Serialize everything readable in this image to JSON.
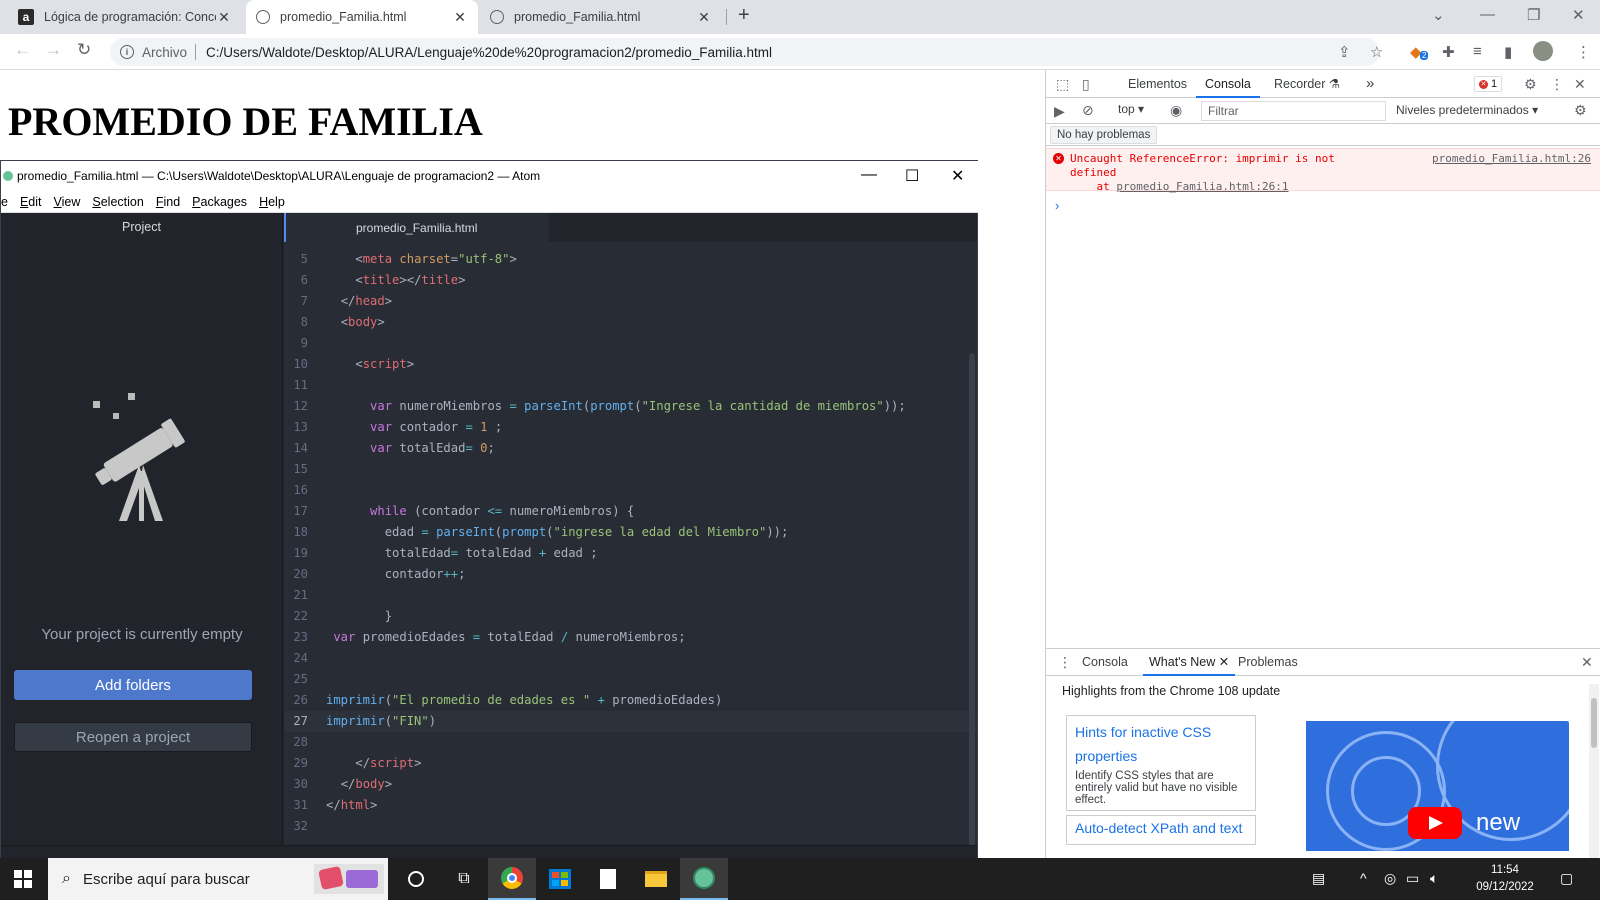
{
  "browser": {
    "tabs": [
      {
        "title": "Lógica de programación: Concep",
        "favicon": "alura-icon",
        "favicon_letter": "a"
      },
      {
        "title": "promedio_Familia.html",
        "favicon": "globe-icon",
        "active": true
      },
      {
        "title": "promedio_Familia.html",
        "favicon": "globe-icon"
      }
    ],
    "new_tab_label": "+",
    "omnibox": {
      "scheme_label": "Archivo",
      "url": "C:/Users/Waldote/Desktop/ALURA/Lenguaje%20de%20programacion2/promedio_Familia.html"
    },
    "extension_badge": "2"
  },
  "page": {
    "heading": "PROMEDIO DE FAMILIA"
  },
  "atom": {
    "title": "promedio_Familia.html — C:\\Users\\Waldote\\Desktop\\ALURA\\Lenguaje de programacion2 — Atom",
    "menu": [
      {
        "label": "e",
        "u": ""
      },
      {
        "label": "dit",
        "u": "E"
      },
      {
        "label": "iew",
        "u": "V"
      },
      {
        "label": "election",
        "u": "S"
      },
      {
        "label": "ind",
        "u": "F"
      },
      {
        "label": "ackages",
        "u": "P"
      },
      {
        "label": "elp",
        "u": "H"
      }
    ],
    "tree": {
      "header": "Project",
      "empty_message": "Your project is currently empty",
      "add_folders": "Add folders",
      "reopen": "Reopen a project"
    },
    "editor_tab": "promedio_Familia.html",
    "code_lines": [
      {
        "n": "5",
        "html": "    <span class='pu'>&lt;</span><span class='tg'>meta</span> <span class='at'>charset</span><span class='pu'>=</span><span class='st'>\"utf-8\"</span><span class='pu'>&gt;</span>"
      },
      {
        "n": "6",
        "html": "    <span class='pu'>&lt;</span><span class='tg'>title</span><span class='pu'>&gt;&lt;/</span><span class='tg'>title</span><span class='pu'>&gt;</span>"
      },
      {
        "n": "7",
        "html": "  <span class='pu'>&lt;/</span><span class='tg'>head</span><span class='pu'>&gt;</span>"
      },
      {
        "n": "8",
        "html": "  <span class='pu'>&lt;</span><span class='tg'>body</span><span class='pu'>&gt;</span>"
      },
      {
        "n": "9",
        "html": ""
      },
      {
        "n": "10",
        "html": "    <span class='pu'>&lt;</span><span class='tg'>script</span><span class='pu'>&gt;</span>"
      },
      {
        "n": "11",
        "html": ""
      },
      {
        "n": "12",
        "html": "      <span class='kw'>var</span> <span class='tx'>numeroMiembros</span> <span class='op'>=</span> <span class='fn'>parseInt</span><span class='pu'>(</span><span class='fn'>prompt</span><span class='pu'>(</span><span class='st'>\"Ingrese la cantidad de miembros\"</span><span class='pu'>));</span>"
      },
      {
        "n": "13",
        "html": "      <span class='kw'>var</span> <span class='tx'>contador</span> <span class='op'>=</span> <span class='nm'>1</span> <span class='pu'>;</span>"
      },
      {
        "n": "14",
        "html": "      <span class='kw'>var</span> <span class='tx'>totalEdad</span><span class='op'>=</span> <span class='nm'>0</span><span class='pu'>;</span>"
      },
      {
        "n": "15",
        "html": ""
      },
      {
        "n": "16",
        "html": ""
      },
      {
        "n": "17",
        "html": "      <span class='kw'>while</span> <span class='pu'>(</span><span class='tx'>contador</span> <span class='op'>&lt;=</span> <span class='tx'>numeroMiembros</span><span class='pu'>) {</span>"
      },
      {
        "n": "18",
        "html": "        <span class='tx'>edad</span> <span class='op'>=</span> <span class='fn'>parseInt</span><span class='pu'>(</span><span class='fn'>prompt</span><span class='pu'>(</span><span class='st'>\"ingrese la edad del Miembro\"</span><span class='pu'>));</span>"
      },
      {
        "n": "19",
        "html": "        <span class='tx'>totalEdad</span><span class='op'>=</span> <span class='tx'>totalEdad</span> <span class='op'>+</span> <span class='tx'>edad</span> <span class='pu'>;</span>"
      },
      {
        "n": "20",
        "html": "        <span class='tx'>contador</span><span class='op'>++</span><span class='pu'>;</span>"
      },
      {
        "n": "21",
        "html": ""
      },
      {
        "n": "22",
        "html": "        <span class='pu'>}</span>"
      },
      {
        "n": "23",
        "html": " <span class='kw'>var</span> <span class='tx'>promedioEdades</span> <span class='op'>=</span> <span class='tx'>totalEdad</span> <span class='op'>/</span> <span class='tx'>numeroMiembros</span><span class='pu'>;</span>"
      },
      {
        "n": "24",
        "html": ""
      },
      {
        "n": "25",
        "html": ""
      },
      {
        "n": "26",
        "html": "<span class='fn'>imprimir</span><span class='pu'>(</span><span class='st'>\"El promedio de edades es \"</span> <span class='op'>+</span> <span class='tx'>promedioEdades</span><span class='pu'>)</span>"
      },
      {
        "n": "27",
        "html": "<span class='fn'>imprimir</span><span class='pu'>(</span><span class='st'>\"FIN\"</span><span class='pu'>)</span>",
        "current": true
      },
      {
        "n": "28",
        "html": ""
      },
      {
        "n": "29",
        "html": "    <span class='pu'>&lt;/</span><span class='tg'>script</span><span class='pu'>&gt;</span>"
      },
      {
        "n": "30",
        "html": "  <span class='pu'>&lt;/</span><span class='tg'>body</span><span class='pu'>&gt;</span>"
      },
      {
        "n": "31",
        "html": "<span class='pu'>&lt;/</span><span class='tg'>html</span><span class='pu'>&gt;</span>"
      },
      {
        "n": "32",
        "html": ""
      }
    ]
  },
  "devtools": {
    "tabs": [
      "Elementos",
      "Consola",
      "Recorder"
    ],
    "more_tabs": "»",
    "error_count": "1",
    "context": "top",
    "filter_placeholder": "Filtrar",
    "levels": "Niveles predeterminados",
    "issues": "No hay problemas",
    "error": {
      "line1": "Uncaught ReferenceError: imprimir is not",
      "line2": "defined",
      "line3_prefix": "    at ",
      "line3_link": "promedio_Familia.html:26:1",
      "source": "promedio_Familia.html:26"
    },
    "prompt_symbol": "›",
    "drawer": {
      "tabs": [
        "Consola",
        "What's New",
        "Problemas"
      ],
      "headline": "Highlights from the Chrome 108 update",
      "card1_title": "Hints for inactive CSS properties",
      "card1_desc": "Identify CSS styles that are entirely valid but have no visible effect.",
      "card2_title": "Auto-detect XPath and text",
      "promo_word": "new"
    }
  },
  "taskbar": {
    "search_placeholder": "Escribe aquí para buscar",
    "time": "11:54",
    "date": "09/12/2022"
  },
  "colors": {
    "atom_bg": "#282c34",
    "devtools_accent": "#1a73e8",
    "error_red": "#e50000"
  }
}
